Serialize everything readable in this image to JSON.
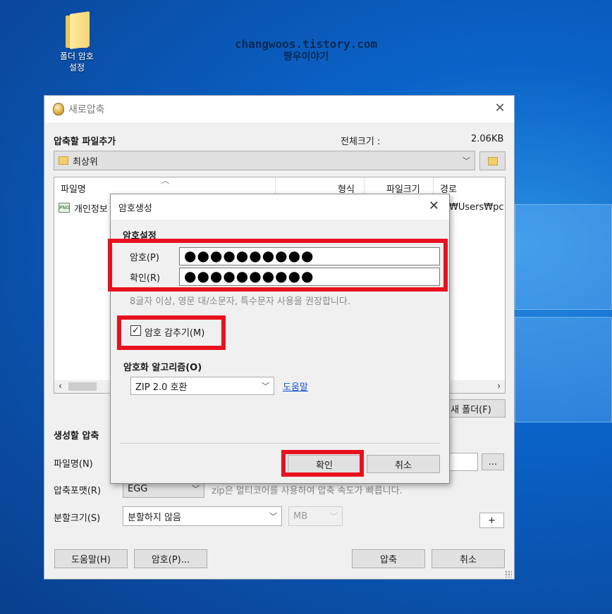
{
  "desktop": {
    "icon_label_line1": "폴더 암호",
    "icon_label_line2": "설정",
    "watermark_line1": "changwoos.tistory.com",
    "watermark_line2": "짱우이야기"
  },
  "main_window": {
    "title": "새로압축",
    "add_files_label": "압축할 파일추가",
    "total_size_label": "전체크기 :",
    "total_size_value": "2.06KB",
    "location_value": "최상위",
    "columns": [
      "파일명",
      "형식",
      "파일크기",
      "경로"
    ],
    "row": {
      "name": "개인정보",
      "path": "₩Users₩pc₩"
    },
    "new_folder_button": "새 폴더(F)",
    "create_section_label": "생성할 압축",
    "filename_label": "파일명(N)",
    "browse_button": "...",
    "format_label": "압축포맷(R)",
    "format_value": "EGG",
    "format_hint": "zip은 멀티코어를 사용하여 압축 속도가 빠릅니다.",
    "split_label": "분할크기(S)",
    "split_value": "분할하지 않음",
    "split_unit": "MB",
    "plus_button": "+",
    "help_button": "도움말(H)",
    "password_button": "암호(P)...",
    "compress_button": "압축",
    "cancel_button": "취소"
  },
  "password_dialog": {
    "title": "암호생성",
    "section_label": "암호설정",
    "password_label": "암호(P)",
    "password_value": "●●●●●●●●●●",
    "confirm_label": "확인(R)",
    "confirm_value": "●●●●●●●●●●",
    "hint": "8글자 이상, 영문 대/소문자, 특수문자 사용을 권장합니다.",
    "hide_checkbox_label": "암호 감추기(M)",
    "hide_checked": true,
    "algorithm_label": "암호화 알고리즘(O)",
    "algorithm_value": "ZIP 2.0 호환",
    "help_link": "도움말",
    "ok_button": "확인",
    "cancel_button": "취소"
  },
  "colors": {
    "highlight_red": "#e8111e",
    "desktop_blue": "#0a63c8",
    "link_blue": "#1a52c8"
  }
}
